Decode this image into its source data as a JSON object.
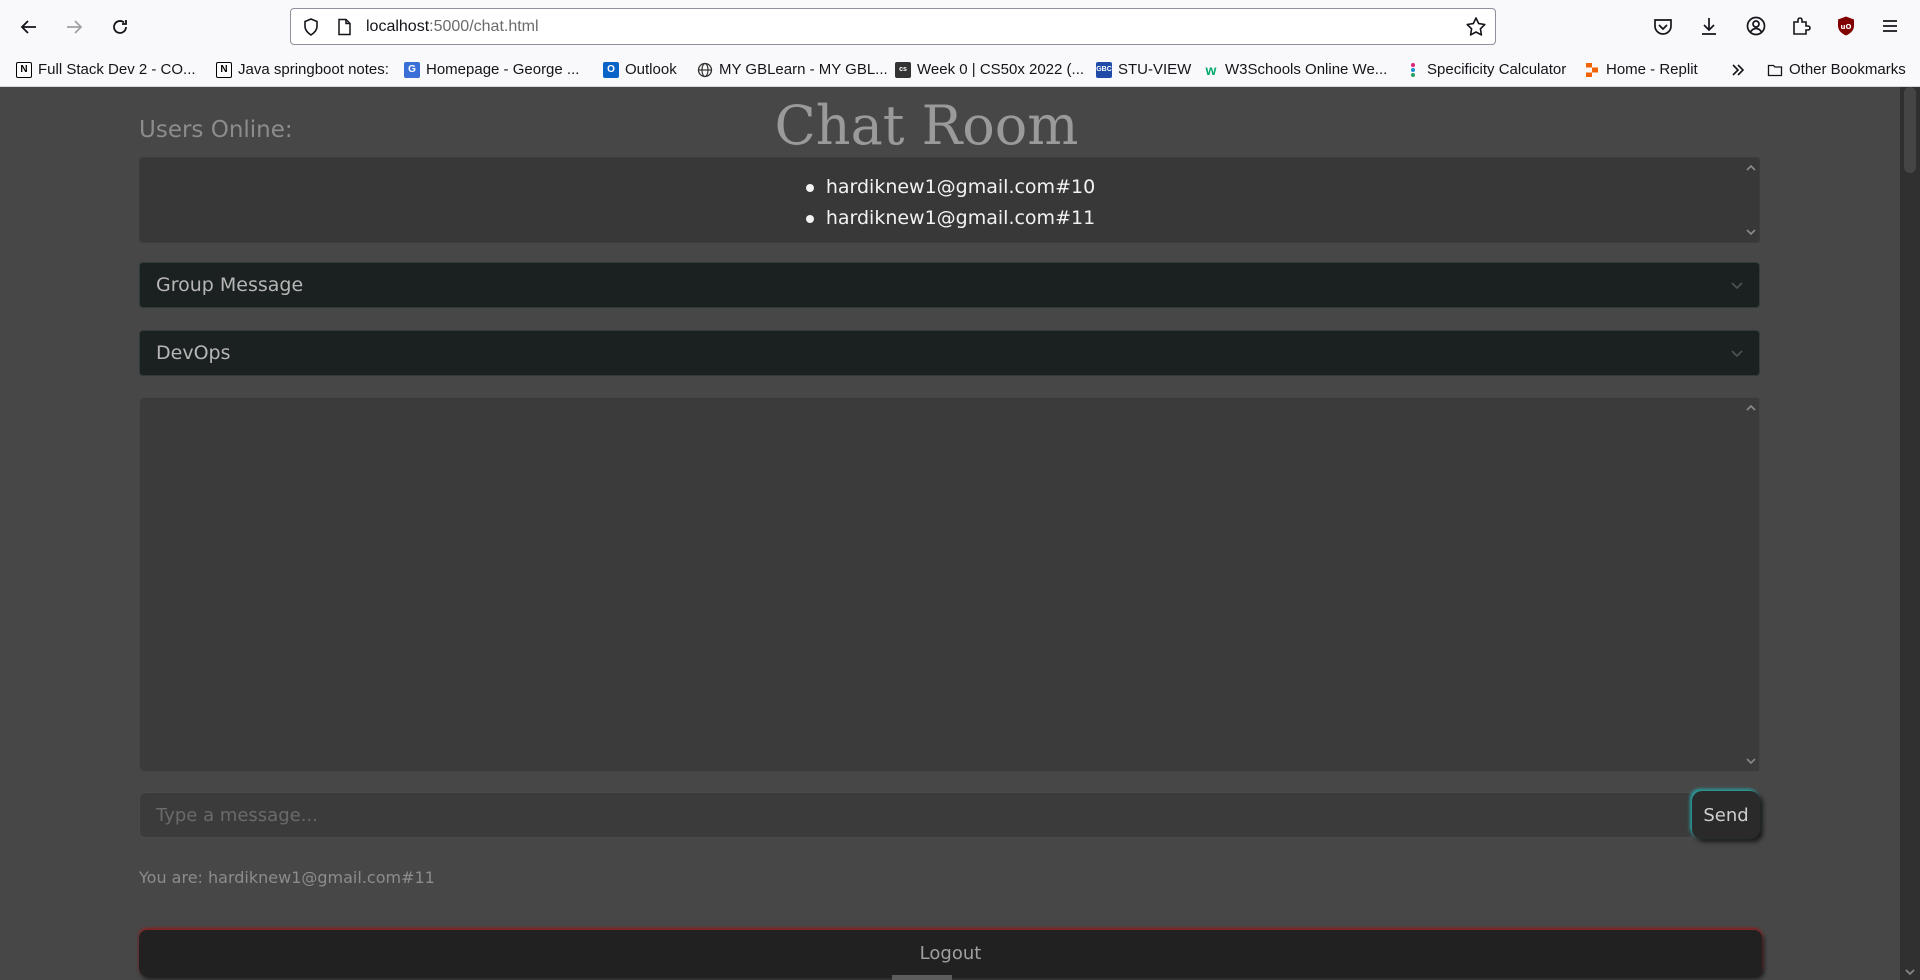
{
  "browser": {
    "url_host": "localhost",
    "url_path": ":5000/chat.html",
    "bookmarks": [
      {
        "label": "Full Stack Dev 2 - CO...",
        "icon": "notion-icon",
        "color": "#000000"
      },
      {
        "label": "Java springboot notes:",
        "icon": "notion-icon",
        "color": "#000000"
      },
      {
        "label": "Homepage - George ...",
        "icon": "homepage-icon",
        "color": "#3b6fd8"
      },
      {
        "label": "Outlook",
        "icon": "outlook-icon",
        "color": "#0a64c8"
      },
      {
        "label": "MY GBLearn - MY GBL...",
        "icon": "globe-icon",
        "color": "#333333"
      },
      {
        "label": "Week 0 | CS50x 2022 (...",
        "icon": "cs50-icon",
        "color": "#333333"
      },
      {
        "label": "STU-VIEW",
        "icon": "gbc-icon",
        "color": "#1f4aa8"
      },
      {
        "label": "W3Schools Online We...",
        "icon": "w3schools-icon",
        "color": "#04aa6d"
      },
      {
        "label": "Specificity Calculator",
        "icon": "specificity-icon",
        "color": "#e0207a"
      },
      {
        "label": "Home - Replit",
        "icon": "replit-icon",
        "color": "#f26207"
      }
    ],
    "other_bookmarks": "Other Bookmarks"
  },
  "page": {
    "users_online_label": "Users Online:",
    "title": "Chat Room",
    "users": [
      "hardiknew1@gmail.com#10",
      "hardiknew1@gmail.com#11"
    ],
    "message_type_select": "Group Message",
    "room_select": "DevOps",
    "message_placeholder": "Type a message...",
    "send_label": "Send",
    "you_are": "You are: hardiknew1@gmail.com#11",
    "logout_label": "Logout"
  }
}
